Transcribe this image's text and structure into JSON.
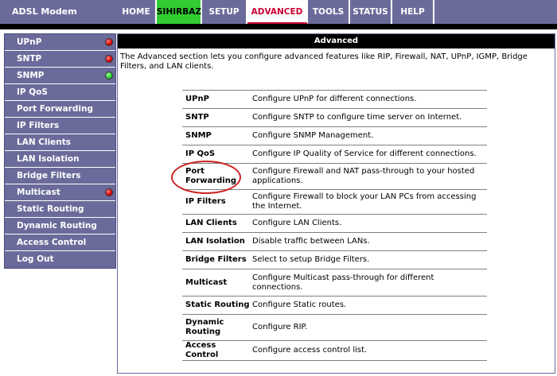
{
  "brand": "ADSL Modem",
  "nav": [
    {
      "label": "HOME",
      "width": 50,
      "style": ""
    },
    {
      "label": "SIHIRBAZ",
      "width": 57,
      "style": "green"
    },
    {
      "label": "SETUP",
      "width": 57,
      "style": ""
    },
    {
      "label": "ADVANCED",
      "width": 76,
      "style": "active"
    },
    {
      "label": "TOOLS",
      "width": 53,
      "style": ""
    },
    {
      "label": "STATUS",
      "width": 53,
      "style": ""
    },
    {
      "label": "HELP",
      "width": 53,
      "style": ""
    }
  ],
  "sidebar": [
    {
      "label": "UPnP",
      "dot": "red"
    },
    {
      "label": "SNTP",
      "dot": "red"
    },
    {
      "label": "SNMP",
      "dot": "green"
    },
    {
      "label": "IP QoS",
      "dot": ""
    },
    {
      "label": "Port Forwarding",
      "dot": ""
    },
    {
      "label": "IP Filters",
      "dot": ""
    },
    {
      "label": "LAN Clients",
      "dot": ""
    },
    {
      "label": "LAN Isolation",
      "dot": ""
    },
    {
      "label": "Bridge Filters",
      "dot": ""
    },
    {
      "label": "Multicast",
      "dot": "red"
    },
    {
      "label": "Static Routing",
      "dot": ""
    },
    {
      "label": "Dynamic Routing",
      "dot": ""
    },
    {
      "label": "Access Control",
      "dot": ""
    },
    {
      "label": "Log Out",
      "dot": ""
    }
  ],
  "main": {
    "title": "Advanced",
    "intro": "The Advanced section lets you configure advanced features like RIP, Firewall, NAT, UPnP, IGMP, Bridge Filters, and LAN clients."
  },
  "features": [
    {
      "name": "UPnP",
      "desc": "Configure UPnP for different connections.",
      "h": 23
    },
    {
      "name": "SNTP",
      "desc": "Configure SNTP to configure time server on Internet.",
      "h": 23
    },
    {
      "name": "SNMP",
      "desc": "Configure SNMP Management.",
      "h": 23
    },
    {
      "name": "IP QoS",
      "desc": "Configure IP Quality of Service for different connections.",
      "h": 23
    },
    {
      "name": "Port Forwarding",
      "desc": "Configure Firewall and NAT pass-through to your hosted applications.",
      "h": 33
    },
    {
      "name": "IP Filters",
      "desc": "Configure Firewall to block your LAN PCs from accessing the Internet.",
      "h": 31
    },
    {
      "name": "LAN Clients",
      "desc": "Configure LAN Clients.",
      "h": 23
    },
    {
      "name": "LAN Isolation",
      "desc": "Disable traffic between LANs.",
      "h": 23
    },
    {
      "name": "Bridge Filters",
      "desc": "Select to setup Bridge Filters.",
      "h": 23
    },
    {
      "name": "Multicast",
      "desc": "Configure Multicast pass-through for different connections.",
      "h": 34
    },
    {
      "name": "Static Routing",
      "desc": "Configure Static routes.",
      "h": 23
    },
    {
      "name": "Dynamic Routing",
      "desc": "Configure RIP.",
      "h": 33
    },
    {
      "name": "Access Control",
      "desc": "Configure access control list.",
      "h": 23
    }
  ],
  "colors": {
    "nav_bg": "#6b6b9b",
    "active_tab_text": "#cc0033",
    "green_tab": "#33cc33",
    "annotation_oval": "#cc2222"
  }
}
